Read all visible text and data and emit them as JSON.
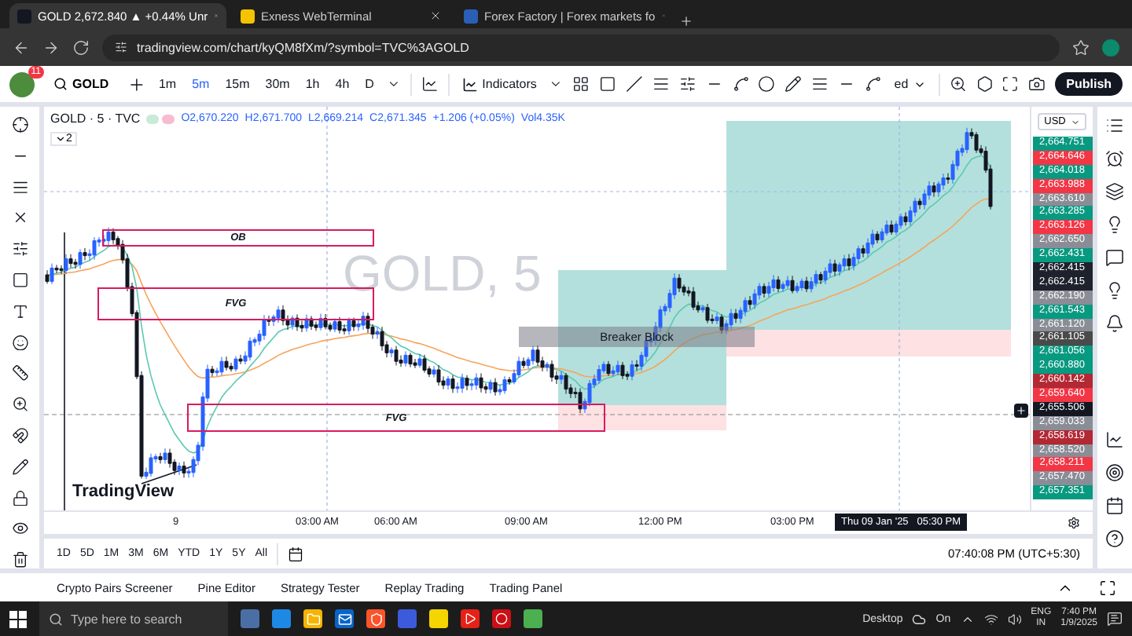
{
  "browser": {
    "tabs": [
      {
        "title": "GOLD 2,672.840 ▲ +0.44% Unr",
        "selected": true
      },
      {
        "title": "Exness WebTerminal",
        "selected": false
      },
      {
        "title": "Forex Factory | Forex markets fo",
        "selected": false
      }
    ],
    "address": "tradingview.com/chart/kyQM8fXm/?symbol=TVC%3AGOLD"
  },
  "toolbar": {
    "notification_count": "11",
    "symbol": "GOLD",
    "intervals": [
      {
        "label": "1m",
        "selected": false
      },
      {
        "label": "5m",
        "selected": true
      },
      {
        "label": "15m",
        "selected": false
      },
      {
        "label": "30m",
        "selected": false
      },
      {
        "label": "1h",
        "selected": false
      },
      {
        "label": "4h",
        "selected": false
      },
      {
        "label": "D",
        "selected": false
      }
    ],
    "indicators": "Indicators",
    "layout_name": "ed",
    "publish": "Publish"
  },
  "legend": {
    "title": "GOLD · 5 · TVC",
    "values": [
      "O2,670.220",
      "H2,671.700",
      "L2,669.214",
      "C2,671.345",
      "+1.206 (+0.05%)",
      "Vol4.35K"
    ],
    "collapsed_count": "2"
  },
  "chart": {
    "watermark": "GOLD, 5",
    "brand": "TradingView",
    "zones": [
      {
        "kind": "outline",
        "label": "OB"
      },
      {
        "kind": "outline",
        "label": "FVG"
      },
      {
        "kind": "outline",
        "label": "FVG"
      },
      {
        "kind": "block",
        "label": "Breaker Block"
      }
    ]
  },
  "price_axis": {
    "currency": "USD",
    "labels": [
      {
        "text": "2,664.751",
        "color": "#089981"
      },
      {
        "text": "2,664.646",
        "color": "#f23645"
      },
      {
        "text": "2,664.018",
        "color": "#089981"
      },
      {
        "text": "2,663.988",
        "color": "#f23645"
      },
      {
        "text": "2,663.610",
        "color": "#8a8d96"
      },
      {
        "text": "2,663.285",
        "color": "#089981"
      },
      {
        "text": "2,663.126",
        "color": "#f23645"
      },
      {
        "text": "2,662.650",
        "color": "#8a8d96"
      },
      {
        "text": "2,662.431",
        "color": "#089981"
      },
      {
        "text": "2,662.415",
        "color": "#1e222d"
      },
      {
        "text": "2,662.415",
        "color": "#1e222d"
      },
      {
        "text": "2,662.190",
        "color": "#8a8d96"
      },
      {
        "text": "2,661.543",
        "color": "#089981"
      },
      {
        "text": "2,661.120",
        "color": "#8a8d96"
      },
      {
        "text": "2,661.105",
        "color": "#4a4a4a"
      },
      {
        "text": "2,661.056",
        "color": "#089981"
      },
      {
        "text": "2,660.880",
        "color": "#089981"
      },
      {
        "text": "2,660.142",
        "color": "#b22833"
      },
      {
        "text": "2,659.640",
        "color": "#f23645"
      },
      {
        "text": "2,655.506",
        "color": "#131722"
      },
      {
        "text": "2,659.033",
        "color": "#8a8d96"
      },
      {
        "text": "2,658.619",
        "color": "#b22833"
      },
      {
        "text": "2,658.520",
        "color": "#8a8d96"
      },
      {
        "text": "2,658.211",
        "color": "#f23645"
      },
      {
        "text": "2,657.470",
        "color": "#8a8d96"
      },
      {
        "text": "2,657.351",
        "color": "#089981"
      }
    ]
  },
  "time_axis": {
    "labels": [
      "9",
      "03:00 AM",
      "06:00 AM",
      "09:00 AM",
      "12:00 PM",
      "03:00 PM"
    ],
    "crosshair_label": "Thu 09 Jan '25   05:30 PM"
  },
  "ranges": [
    "1D",
    "5D",
    "1M",
    "3M",
    "6M",
    "YTD",
    "1Y",
    "5Y",
    "All"
  ],
  "clock": "07:40:08 PM (UTC+5:30)",
  "bottom_tabs": [
    "Crypto Pairs Screener",
    "Pine Editor",
    "Strategy Tester",
    "Replay Trading",
    "Trading Panel"
  ],
  "taskbar": {
    "search_placeholder": "Type here to search",
    "desktop": "Desktop",
    "weather": "On",
    "language": "ENG",
    "region": "IN",
    "time": "7:40 PM",
    "date": "1/9/2025"
  }
}
